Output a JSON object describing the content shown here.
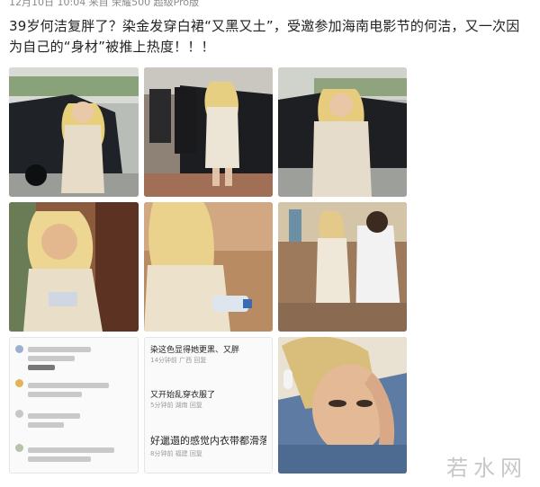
{
  "post": {
    "meta": "12月10日 10:04  来自 荣耀500 超级Pro版",
    "text": "39岁何洁复胖了？染金发穿白裙“又黑又土”，受邀参加海南电影节的何洁，又一次因为自己的“身材”被推上热度！！！"
  },
  "screenshots": {
    "left": {
      "rows": [
        {
          "name": "",
          "text": "",
          "meta": ""
        },
        {
          "name": "",
          "text": "",
          "meta": ""
        }
      ]
    },
    "middle": {
      "c1_text": "染这色显得她更黑、又胖",
      "c1_meta": "14分钟前  广西  回复",
      "c2_text": "又开始乱穿衣服了",
      "c2_meta": "5分钟前  湖南  回复",
      "c3_text": "好邋遢的感觉内衣带都滑落了。",
      "c3_meta": "8分钟前  福建   回复"
    }
  },
  "colors": {
    "link_blue": "#576b95",
    "watermark": "#c8c8c8"
  },
  "watermark": "若水网"
}
